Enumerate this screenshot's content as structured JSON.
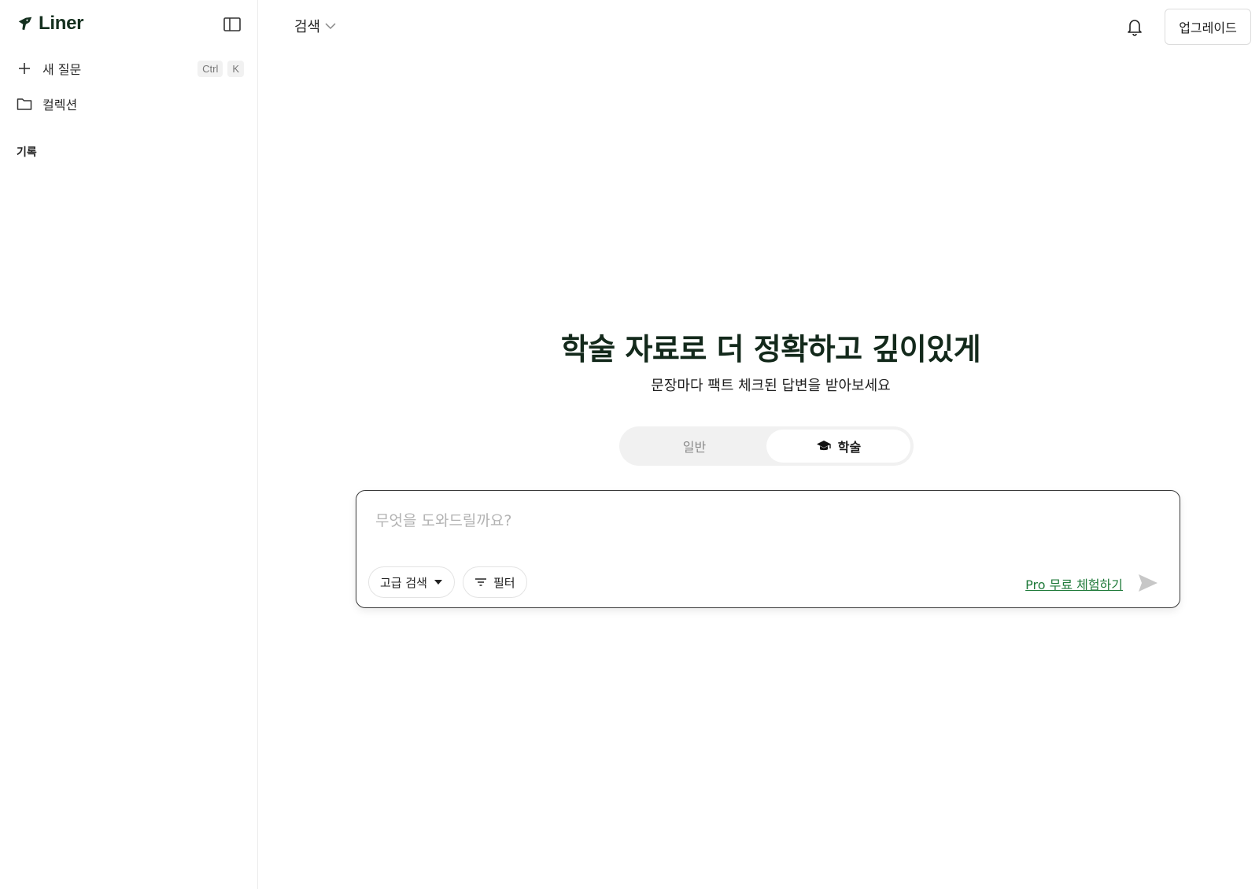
{
  "sidebar": {
    "logo_text": "Liner",
    "new_question": {
      "label": "새 질문",
      "shortcut": [
        "Ctrl",
        "K"
      ]
    },
    "collections": {
      "label": "컬렉션"
    },
    "history_label": "기록"
  },
  "header": {
    "mode_label": "검색",
    "upgrade_label": "업그레이드"
  },
  "hero": {
    "title": "학술 자료로 더 정확하고 깊이있게",
    "subtitle": "문장마다 팩트 체크된 답변을 받아보세요"
  },
  "tabs": [
    {
      "label": "일반",
      "active": false
    },
    {
      "label": "학술",
      "active": true,
      "icon": "graduation-cap-icon"
    }
  ],
  "search": {
    "placeholder": "무엇을 도와드릴까요?",
    "value": "",
    "advanced_label": "고급 검색",
    "filter_label": "필터",
    "pro_trial_label": "Pro 무료 체험하기"
  },
  "colors": {
    "brand": "#15301f",
    "accent_green": "#1f7a3a",
    "send_disabled": "#c7c7c7"
  }
}
